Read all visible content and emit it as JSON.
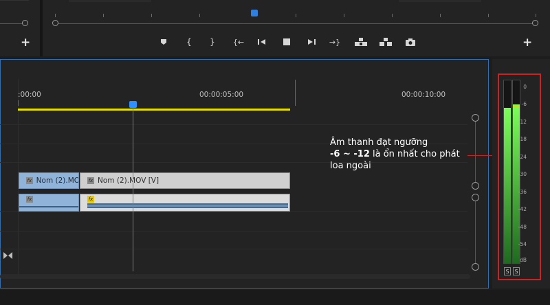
{
  "program_monitor": {
    "controls": [
      {
        "name": "marker-icon",
        "glyph": "⬟"
      },
      {
        "name": "mark-in-icon",
        "glyph": "{"
      },
      {
        "name": "mark-out-icon",
        "glyph": "}"
      },
      {
        "name": "go-to-in-icon",
        "glyph": "{←"
      },
      {
        "name": "step-back-icon",
        "glyph": "◂|"
      },
      {
        "name": "stop-icon",
        "glyph": "■"
      },
      {
        "name": "step-forward-icon",
        "glyph": "|▸"
      },
      {
        "name": "go-to-out-icon",
        "glyph": "→}"
      },
      {
        "name": "lift-icon",
        "glyph": "▟▙"
      },
      {
        "name": "extract-icon",
        "glyph": "▞▚"
      },
      {
        "name": "export-frame-icon",
        "glyph": "◉"
      }
    ],
    "add_button_left": "+",
    "add_button_right": "+"
  },
  "timeline": {
    "timecodes": [
      ":00:00",
      "00:00:05:00",
      "00:00:10:00"
    ],
    "video_clips": [
      {
        "label": "Nom (2).MO",
        "fx": "fx"
      },
      {
        "label": "Nom (2).MOV [V]",
        "fx": "fx"
      }
    ],
    "audio_clips": [
      {
        "fx": "fx"
      },
      {
        "fx": "fx"
      }
    ],
    "accent_color": "#2f6fb8",
    "work_area_color": "#e8e000"
  },
  "audio_meter": {
    "scale": [
      "0",
      "-6",
      "-12",
      "-18",
      "-24",
      "-30",
      "-36",
      "-42",
      "-48",
      "-54",
      "dB"
    ],
    "solo_left": "S",
    "solo_right": "S",
    "level_left_db": -9,
    "level_right_db": -8,
    "peak_db": -6,
    "highlight_color": "#d21f1f"
  },
  "annotation": {
    "line1": "Âm thanh đạt ngưỡng",
    "range": "-6 ~ -12",
    "line2_rest": " là ổn nhất cho phát",
    "line3": "loa ngoài"
  }
}
